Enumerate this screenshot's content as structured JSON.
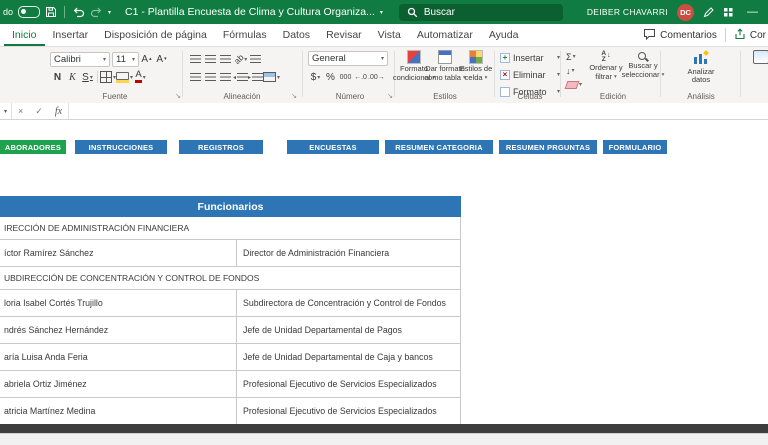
{
  "colors": {
    "excel_green": "#107C41",
    "nav_blue": "#2E75B6",
    "nav_green": "#1FA24D",
    "table_header_blue": "#2E75B6",
    "avatar_red": "#C94F43"
  },
  "titlebar": {
    "autosave_label": "do",
    "filename": "C1 - Plantilla Encuesta de Clima y Cultura Organiza...",
    "search_placeholder": "Buscar",
    "user_name": "DEIBER CHAVARRI",
    "avatar_initials": "DC"
  },
  "ribbon_tabs": [
    {
      "id": "inicio",
      "label": "Inicio",
      "active": true
    },
    {
      "id": "insertar",
      "label": "Insertar"
    },
    {
      "id": "disposicion-de-pagina",
      "label": "Disposición de página"
    },
    {
      "id": "formulas",
      "label": "Fórmulas"
    },
    {
      "id": "datos",
      "label": "Datos"
    },
    {
      "id": "revisar",
      "label": "Revisar"
    },
    {
      "id": "vista",
      "label": "Vista"
    },
    {
      "id": "automatizar",
      "label": "Automatizar"
    },
    {
      "id": "ayuda",
      "label": "Ayuda"
    }
  ],
  "top_right": {
    "comments": "Comentarios",
    "share": "Cor"
  },
  "ribbon": {
    "font": {
      "family": "Calibri",
      "size": "11",
      "bold": "N",
      "italic": "K",
      "underline": "S",
      "label": "Fuente"
    },
    "alignment": {
      "label": "Alineación"
    },
    "number": {
      "format": "General",
      "accounting": "$",
      "percent": "%",
      "thousands": "000",
      "inc_decimal": "←.0",
      "dec_decimal": ".00→",
      "label": "Número"
    },
    "styles": {
      "conditional_l1": "Formato",
      "conditional_l2": "condicional",
      "table_l1": "Dar formato",
      "table_l2": "como tabla",
      "cell_l1": "Estilos de",
      "cell_l2": "celda",
      "label": "Estilos"
    },
    "cells": {
      "insert": "Insertar",
      "delete": "Eliminar",
      "format": "Formato",
      "label": "Celdas"
    },
    "editing": {
      "sum": "Σ",
      "sort_l1": "Ordenar y",
      "sort_l2": "filtrar",
      "find_l1": "Buscar y",
      "find_l2": "seleccionar",
      "label": "Edición"
    },
    "analysis": {
      "l1": "Analizar",
      "l2": "datos",
      "label": "Análisis"
    }
  },
  "formula_bar": {
    "cancel": "×",
    "enter": "✓",
    "fx": "fx"
  },
  "nav_buttons": [
    {
      "id": "colaboradores",
      "label": "ABORADORES",
      "style": "green"
    },
    {
      "id": "instrucciones",
      "label": "INSTRUCCIONES",
      "style": "blue"
    },
    {
      "id": "registros",
      "label": "REGISTROS",
      "style": "blue"
    },
    {
      "id": "encuestas",
      "label": "ENCUESTAS",
      "style": "blue"
    },
    {
      "id": "resumen-categoria",
      "label": "RESUMEN CATEGORIA",
      "style": "blue"
    },
    {
      "id": "resumen-preguntas",
      "label": "RESUMEN PRGUNTAS",
      "style": "blue"
    },
    {
      "id": "formulario",
      "label": "FORMULARIO",
      "style": "blue"
    }
  ],
  "table": {
    "title": "Funcionarios",
    "rows": [
      {
        "type": "section",
        "text": "IRECCIÓN DE ADMINISTRACIÓN FINANCIERA"
      },
      {
        "type": "person",
        "name": "íctor Ramírez Sánchez",
        "title": "Director de Administración Financiera"
      },
      {
        "type": "section",
        "text": "UBDIRECCIÓN DE CONCENTRACIÓN Y CONTROL DE FONDOS"
      },
      {
        "type": "person",
        "name": "loria Isabel Cortés Trujillo",
        "title": "Subdirectora de Concentración y Control de Fondos"
      },
      {
        "type": "person",
        "name": "ndrés Sánchez Hernández",
        "title": "Jefe de Unidad Departamental de Pagos"
      },
      {
        "type": "person",
        "name": "aría Luisa Anda Feria",
        "title": "Jefe de Unidad Departamental de Caja y bancos"
      },
      {
        "type": "person",
        "name": "abriela Ortiz Jiménez",
        "title": "Profesional Ejecutivo de Servicios Especializados"
      },
      {
        "type": "person",
        "name": "atricia Martínez Medina",
        "title": "Profesional Ejecutivo de Servicios Especializados"
      }
    ]
  }
}
